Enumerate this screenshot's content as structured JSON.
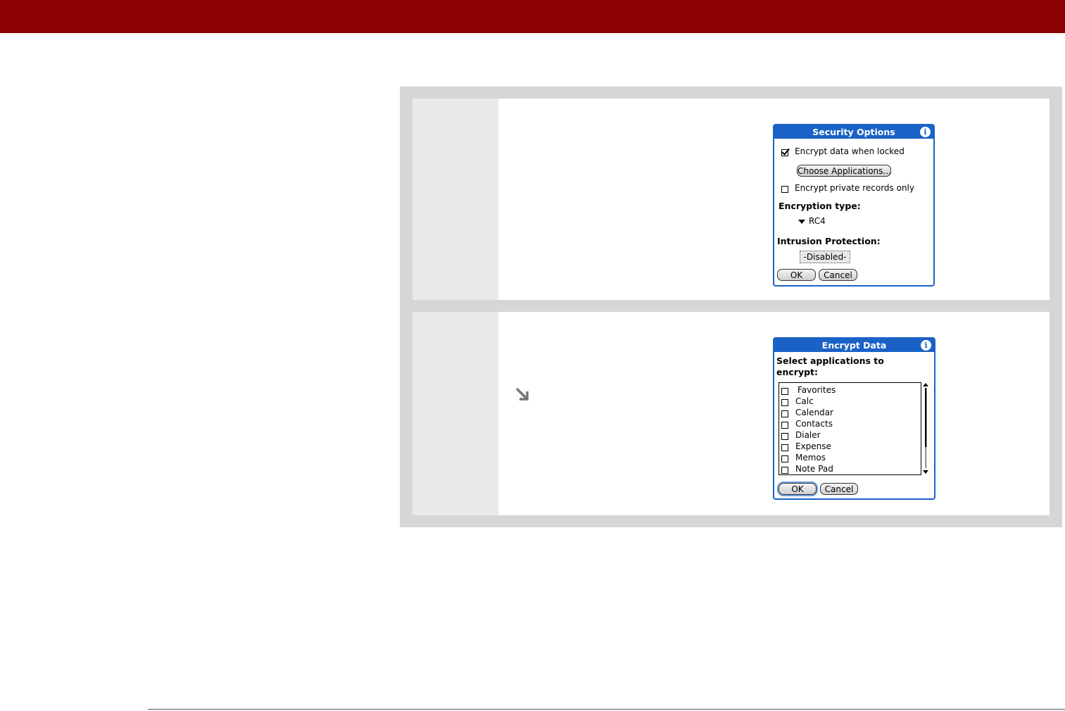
{
  "security_options": {
    "title": "Security Options",
    "encrypt_when_locked": {
      "label": "Encrypt data when locked",
      "checked": true
    },
    "choose_apps_button": "Choose Applications...",
    "encrypt_private": {
      "label": "Encrypt private records only",
      "checked": false
    },
    "encryption_type_label": "Encryption type:",
    "encryption_type_value": "RC4",
    "intrusion_label": "Intrusion Protection:",
    "intrusion_value": "-Disabled-",
    "ok": "OK",
    "cancel": "Cancel"
  },
  "encrypt_data": {
    "title": "Encrypt Data",
    "prompt_line1": "Select applications to",
    "prompt_line2": "encrypt:",
    "apps": [
      "Favorites",
      "Calc",
      "Calendar",
      "Contacts",
      "Dialer",
      "Expense",
      "Memos",
      "Note Pad"
    ],
    "ok": "OK",
    "cancel": "Cancel"
  },
  "colors": {
    "header_bar": "#8b0003",
    "palm_blue": "#1a62c6",
    "panel_gray": "#d6d6d6"
  }
}
